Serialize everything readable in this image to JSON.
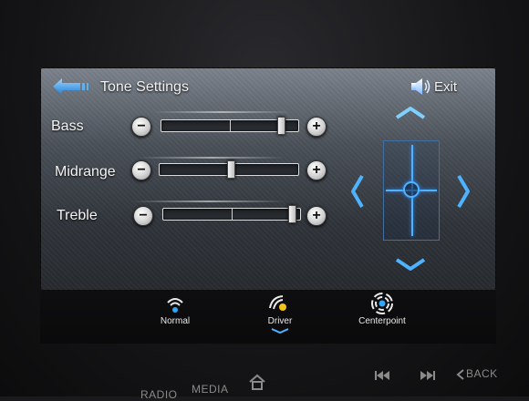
{
  "header": {
    "title": "Tone Settings",
    "exit_label": "Exit"
  },
  "sliders": [
    {
      "label": "Bass",
      "level": 0.9
    },
    {
      "label": "Midrange",
      "level": 0.52
    },
    {
      "label": "Treble",
      "level": 0.97
    }
  ],
  "presets": [
    {
      "label": "Normal",
      "selected": false
    },
    {
      "label": "Driver",
      "selected": true
    },
    {
      "label": "Centerpoint",
      "selected": false
    }
  ],
  "hardware": {
    "radio": "RADIO",
    "media": "MEDIA",
    "back": "BACK"
  },
  "colors": {
    "accent": "#4fb2ff",
    "selected_preset": "#f0c419"
  }
}
